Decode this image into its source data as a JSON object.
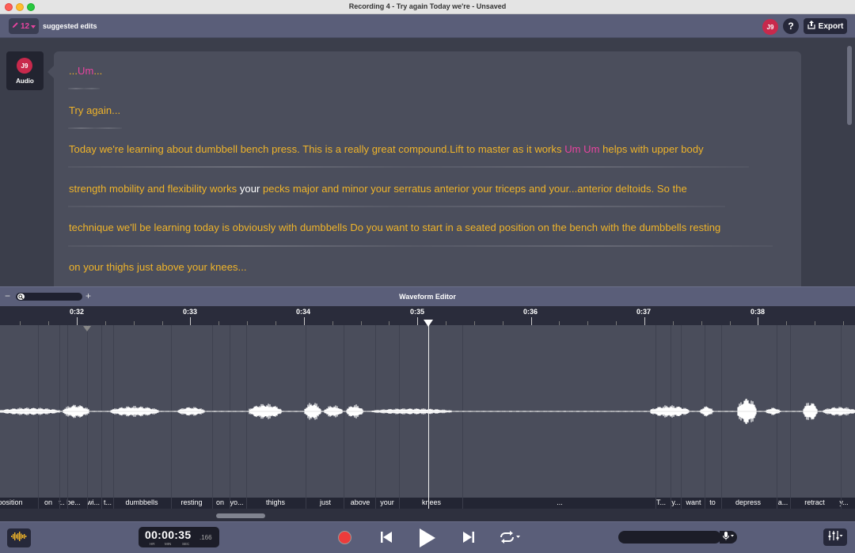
{
  "window": {
    "title": "Recording 4 - Try again Today we're - Unsaved"
  },
  "toolbar": {
    "edits_count": "12",
    "edits_label": "suggested edits",
    "user_initials": "J9",
    "help_label": "?",
    "export_label": "Export"
  },
  "speaker": {
    "initials": "J9",
    "label": "Audio"
  },
  "transcript": {
    "line1": {
      "a": "...",
      "b": "Um",
      "c": "..."
    },
    "line2": "Try again...",
    "line3": {
      "a": "Today we're learning about dumbbell bench press. This is a really great compound.Lift to master as it works ",
      "b": "Um Um",
      "c": " helps with upper body"
    },
    "line4": {
      "a": "strength mobility and flexibility works ",
      "b": "your",
      "c": " pecks major and minor your serratus anterior your triceps and your...anterior deltoids. So the"
    },
    "line5": "technique we'll be learning today is obviously with dumbbells Do you want to start in a seated position on the bench with the dumbbells resting",
    "line6": "on your thighs just above your knees..."
  },
  "waveform_editor": {
    "title": "Waveform Editor",
    "zoom_minus": "−",
    "zoom_plus": "+",
    "time_labels": [
      "0:32",
      "0:33",
      "0:34",
      "0:35",
      "0:36",
      "0:37",
      "0:38"
    ],
    "words": [
      "position",
      "on",
      "t..",
      "be...",
      "wi...",
      "t...",
      "dumbbells",
      "resting",
      "on",
      "yo...",
      "thighs",
      "just",
      "above",
      "your",
      "knees",
      "...",
      "T...",
      "y...",
      "want",
      "to",
      "depress",
      "a...",
      "retract",
      "y..."
    ]
  },
  "transport": {
    "timecode": "00:00:35",
    "timecode_frac": ".166",
    "unit_hr": "HR",
    "unit_min": "MIN",
    "unit_sec": "SEC"
  },
  "colors": {
    "transcript_text": "#f0b429",
    "filler_word": "#e944a0",
    "avatar": "#c8294c",
    "record": "#ec3b3b",
    "toolbar_bg": "#5a5e79"
  }
}
